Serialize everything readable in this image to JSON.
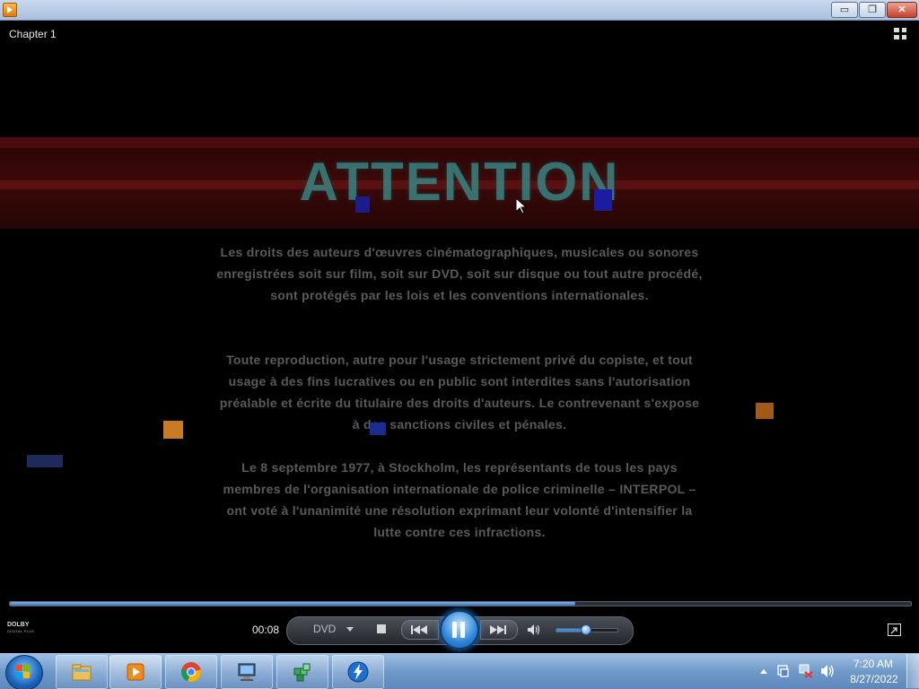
{
  "window": {
    "minimize_label": "▭",
    "maximize_label": "❐",
    "close_label": "✕"
  },
  "player": {
    "chapter": "Chapter 1",
    "heading": "ATTENTION",
    "paragraphs": [
      "Les droits des auteurs d'œuvres cinématographiques, musicales ou sonores enregistrées soit sur film, soit sur DVD, soit sur disque ou tout autre procédé, sont protégés par les lois et les conventions internationales.",
      "Toute reproduction, autre pour l'usage strictement privé du copiste, et tout usage à des fins lucratives ou en public sont interdites sans l'autorisation préalable et écrite du titulaire des droits d'auteurs. Le contrevenant s'expose à des sanctions civiles et pénales.",
      "Le 8 septembre 1977, à Stockholm, les représentants de tous les pays membres de l'organisation internationale de police criminelle – INTERPOL – ont voté à l'unanimité une résolution exprimant leur volonté d'intensifier la lutte contre ces infractions."
    ],
    "seek_progress": 0.627,
    "elapsed": "00:08",
    "source": "DVD",
    "volume_level": 0.5,
    "dolby_mark": "DOLBY",
    "dolby_sub": "DIGITAL PLUS"
  },
  "icons": {
    "app": "media-player-icon",
    "switch_view": "switch-to-library-icon",
    "fullscreen": "fullscreen-icon",
    "stop": "stop-icon",
    "prev": "previous-icon",
    "next": "next-icon",
    "pause": "pause-icon",
    "mute": "speaker-icon"
  },
  "taskbar": {
    "items": [
      "windows-explorer",
      "windows-media-player",
      "google-chrome",
      "computer",
      "package-installer",
      "lightning-app"
    ],
    "clock_time": "7:20 AM",
    "clock_date": "8/27/2022"
  },
  "colors": {
    "accent": "#2e85d8",
    "seek_fill": "#5a95d4",
    "heading": "#3a8a8a",
    "banner": "#3d0909"
  }
}
